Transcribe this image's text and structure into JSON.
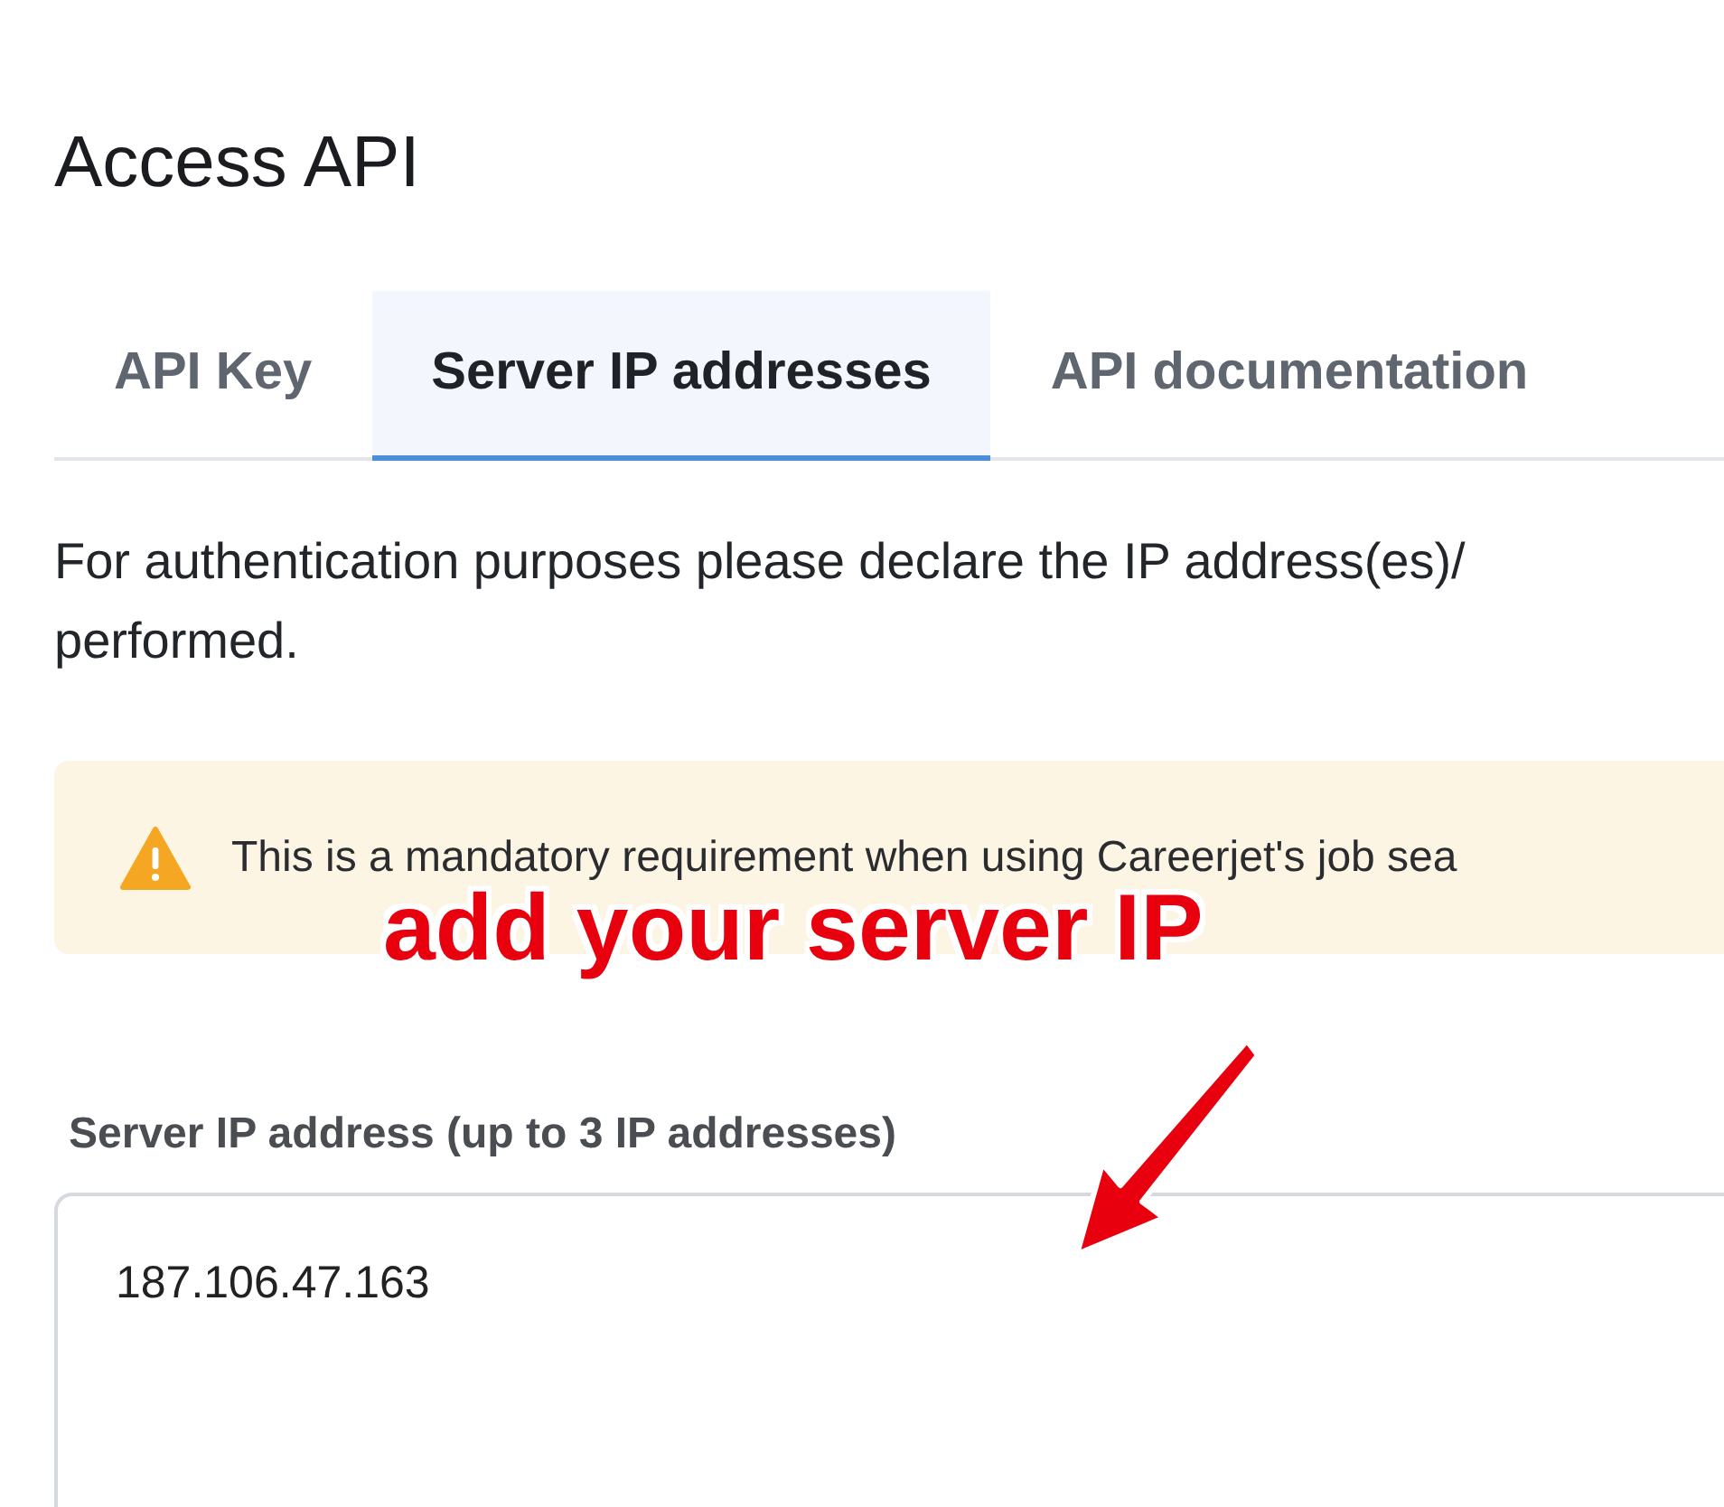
{
  "page": {
    "title": "Access API"
  },
  "tabs": [
    {
      "label": "API Key",
      "selected": false
    },
    {
      "label": "Server IP addresses",
      "selected": true
    },
    {
      "label": "API documentation",
      "selected": false
    }
  ],
  "intro_lines": [
    "For authentication purposes please declare the IP address(es)/",
    "performed."
  ],
  "warning": {
    "text": "This is a mandatory requirement when using Careerjet's job sea"
  },
  "ip_field": {
    "label": "Server IP address (up to 3 IP addresses)",
    "value": "187.106.47.163"
  },
  "annotation": {
    "text": "add your server IP"
  }
}
